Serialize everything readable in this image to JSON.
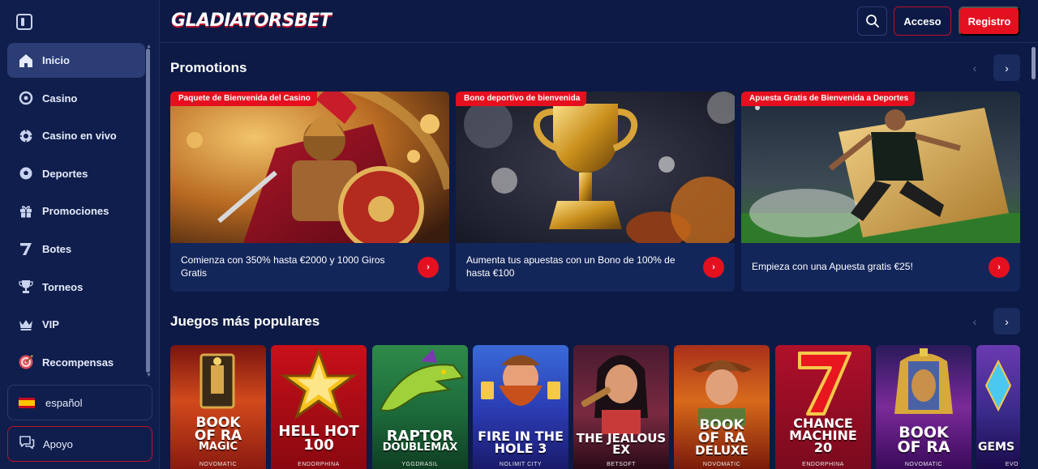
{
  "header": {
    "logo_text": "GLADIATORSBET",
    "login_label": "Acceso",
    "register_label": "Registro"
  },
  "sidebar": {
    "items": [
      {
        "label": "Inicio",
        "icon": "home-icon",
        "active": true
      },
      {
        "label": "Casino",
        "icon": "casino-icon",
        "active": false
      },
      {
        "label": "Casino en vivo",
        "icon": "live-casino-icon",
        "active": false
      },
      {
        "label": "Deportes",
        "icon": "soccer-ball-icon",
        "active": false
      },
      {
        "label": "Promociones",
        "icon": "gift-icon",
        "active": false
      },
      {
        "label": "Botes",
        "icon": "seven-icon",
        "active": false
      },
      {
        "label": "Torneos",
        "icon": "trophy-icon",
        "active": false
      },
      {
        "label": "VIP",
        "icon": "crown-icon",
        "active": false
      },
      {
        "label": "Recompensas",
        "icon": "target-icon",
        "active": false
      }
    ],
    "language_label": "español",
    "support_label": "Apoyo"
  },
  "promotions": {
    "title": "Promotions",
    "cards": [
      {
        "tag": "Paquete de Bienvenida del Casino",
        "text": "Comienza con 350% hasta €2000 y 1000 Giros Gratis"
      },
      {
        "tag": "Bono deportivo de bienvenida",
        "text": "Aumenta tus apuestas con un Bono de 100% de hasta €100"
      },
      {
        "tag": "Apuesta Gratis de Bienvenida a Deportes",
        "text": "Empieza con una Apuesta gratis €25!"
      }
    ]
  },
  "popular_games": {
    "title": "Juegos más populares",
    "games": [
      {
        "title_lines": [
          "BOOK",
          "OF RA",
          "MAGIC"
        ],
        "provider": "NOVOMATIC"
      },
      {
        "title_lines": [
          "HELL HOT",
          "100"
        ],
        "provider": "ENDORPHINA"
      },
      {
        "title_lines": [
          "RAPTOR",
          "DOUBLEMAX"
        ],
        "provider": "YGGDRASIL"
      },
      {
        "title_lines": [
          "FIRE IN THE",
          "HOLE 3"
        ],
        "provider": "NOLIMIT CITY"
      },
      {
        "title_lines": [
          "THE JEALOUS",
          "EX"
        ],
        "provider": "BETSOFT"
      },
      {
        "title_lines": [
          "BOOK",
          "OF RA",
          "DELUXE"
        ],
        "provider": "NOVOMATIC"
      },
      {
        "title_lines": [
          "CHANCE",
          "MACHINE",
          "20"
        ],
        "provider": "ENDORPHINA"
      },
      {
        "title_lines": [
          "BOOK",
          "OF RA"
        ],
        "provider": "NOVOMATIC"
      },
      {
        "title_lines": [
          "GEMS"
        ],
        "provider": "EVO"
      }
    ]
  },
  "colors": {
    "background": "#0c1a45",
    "sidebar": "#0f1e4c",
    "accent_red": "#e5101f",
    "active_item": "#2b3d74"
  }
}
